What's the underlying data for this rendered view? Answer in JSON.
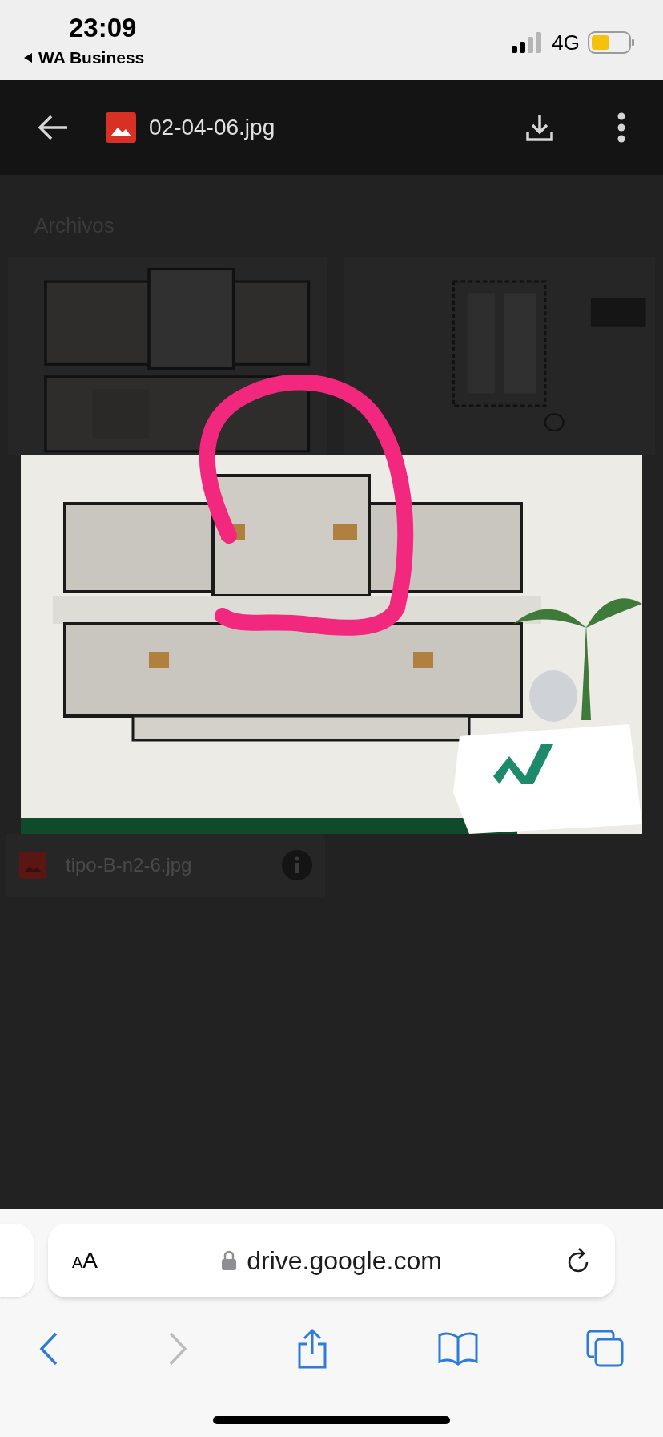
{
  "status_bar": {
    "time": "23:09",
    "back_app": "WA Business",
    "network": "4G",
    "battery": {
      "level": 0.5
    }
  },
  "viewer": {
    "file_name": "02-04-06.jpg"
  },
  "files": {
    "heading": "Archivos",
    "items": [
      {
        "name": "tipo-B-n2-6.jpg"
      }
    ]
  },
  "browser": {
    "text_size_button": "AA",
    "url": "drive.google.com",
    "nav": [
      {
        "kind": "back",
        "disabled": false
      },
      {
        "kind": "forward",
        "disabled": true
      }
    ]
  }
}
